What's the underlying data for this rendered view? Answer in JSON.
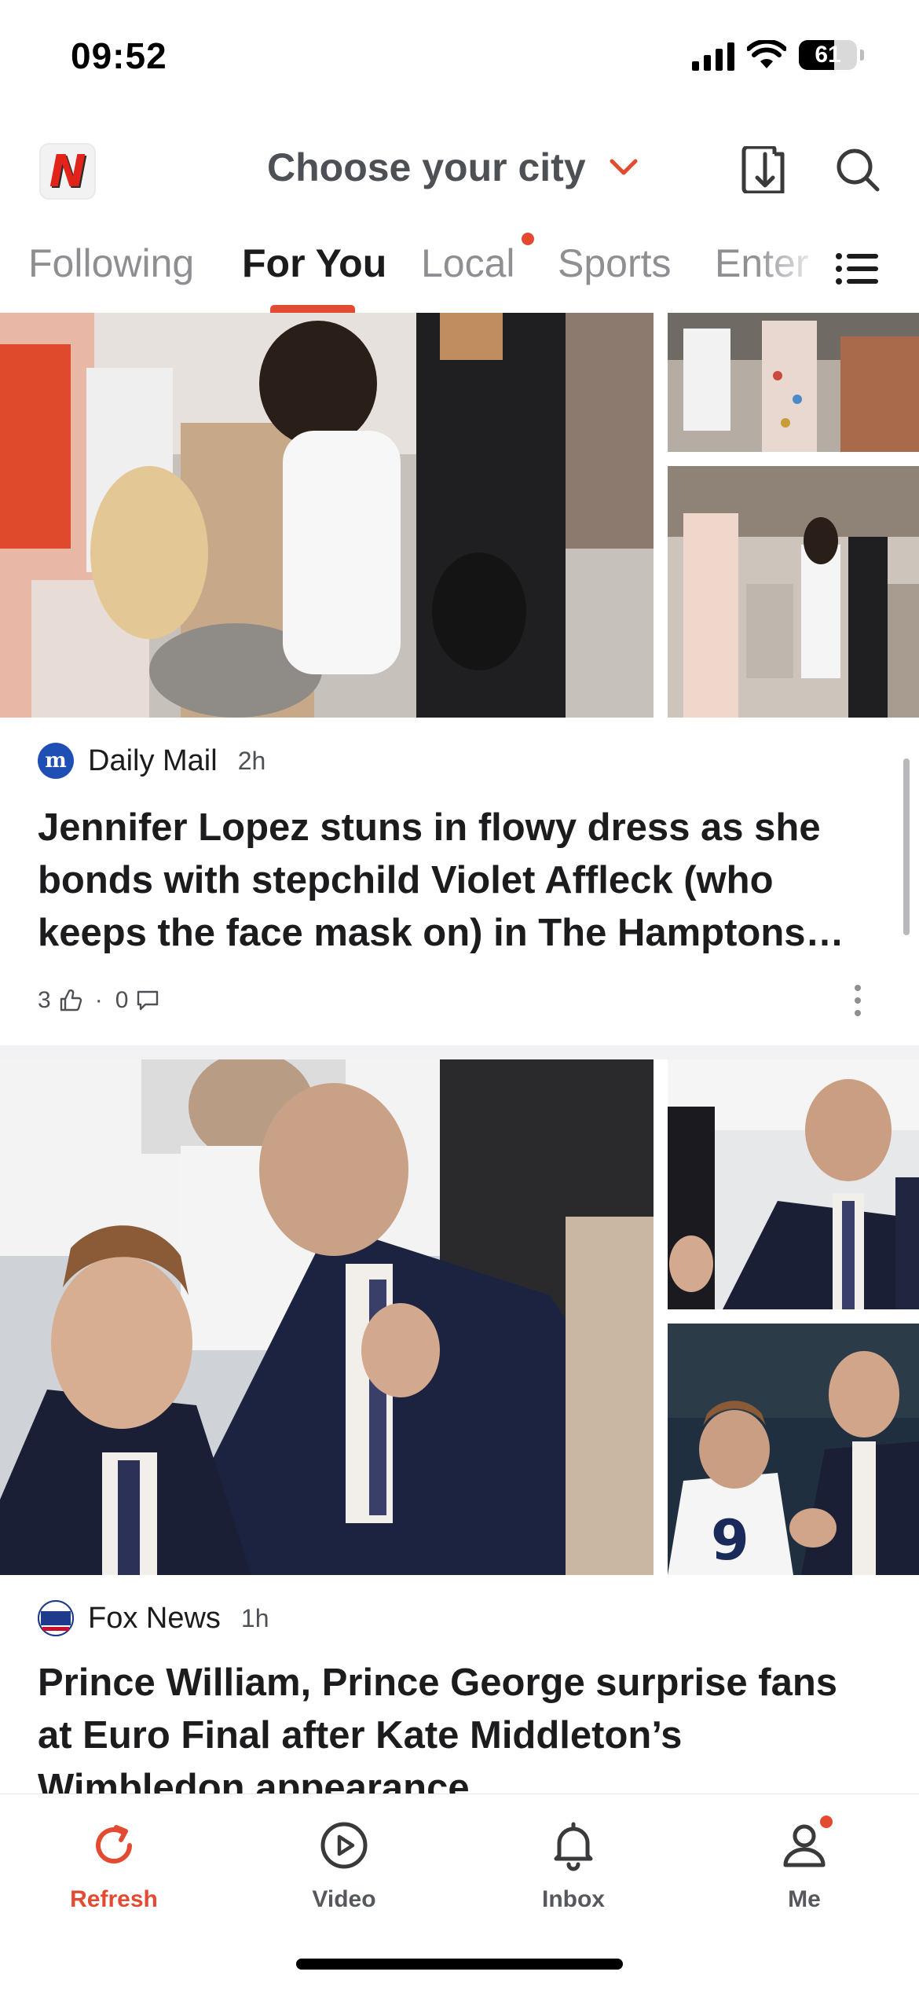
{
  "status_bar": {
    "time": "09:52",
    "battery": "61",
    "battery_level": 0.61
  },
  "header": {
    "city_label": "Choose your city"
  },
  "tabs": [
    {
      "label": "Following"
    },
    {
      "label": "For You"
    },
    {
      "label": "Local"
    },
    {
      "label": "Sports"
    },
    {
      "label": "Enter"
    }
  ],
  "articles": [
    {
      "source": "Daily Mail",
      "time": "2h",
      "headline_lines": [
        "Jennifer Lopez stuns in flowy dress as she",
        "bonds with stepchild Violet Affleck (who",
        "keeps the face mask on) in The Hamptons…"
      ],
      "likes": "3",
      "comments": "0"
    },
    {
      "source": "Fox News",
      "time": "1h",
      "headline_lines": [
        "Prince William, Prince George surprise fans",
        "at Euro Final after Kate Middleton’s",
        "Wimbledon appearance"
      ]
    }
  ],
  "bottom_nav": [
    {
      "label": "Refresh"
    },
    {
      "label": "Video"
    },
    {
      "label": "Inbox"
    },
    {
      "label": "Me"
    }
  ],
  "colors": {
    "accent": "#e24b32",
    "text": "#1c1c1e",
    "muted": "#8e8e93"
  }
}
